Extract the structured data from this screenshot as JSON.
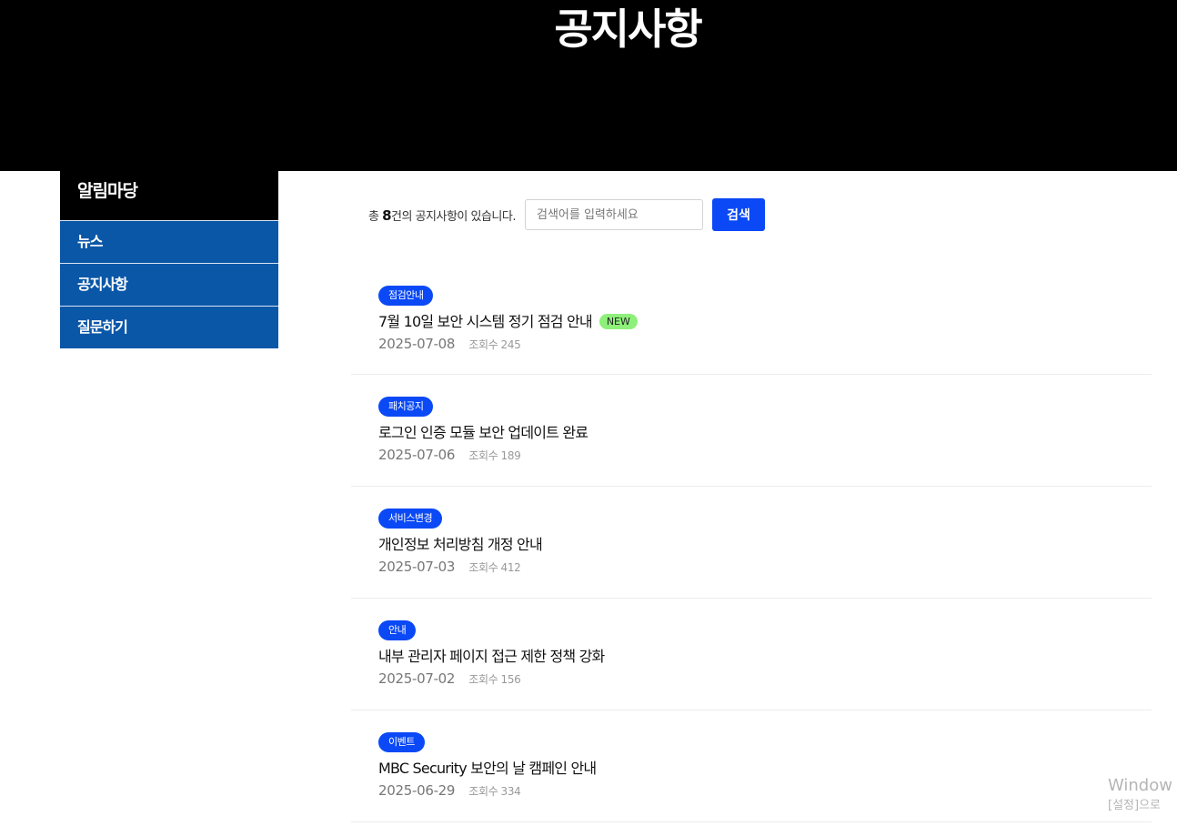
{
  "hero": {
    "title": "공지사항"
  },
  "sidebar": {
    "title": "알림마당",
    "items": [
      {
        "label": "뉴스"
      },
      {
        "label": "공지사항"
      },
      {
        "label": "질문하기"
      }
    ]
  },
  "toolbar": {
    "count_prefix": "총 ",
    "count": "8",
    "count_suffix": "건의 공지사항이 있습니다.",
    "search_placeholder": "검색어를 입력하세요",
    "search_value": "",
    "search_button": "검색"
  },
  "posts": [
    {
      "tag": "점검안내",
      "title": "7월 10일 보안 시스템 정기 점검 안내",
      "new_badge": "NEW",
      "date": "2025-07-08",
      "views_label": "조회수",
      "views": "245"
    },
    {
      "tag": "패치공지",
      "title": "로그인 인증 모듈 보안 업데이트 완료",
      "date": "2025-07-06",
      "views_label": "조회수",
      "views": "189"
    },
    {
      "tag": "서비스변경",
      "title": "개인정보 처리방침 개정 안내",
      "date": "2025-07-03",
      "views_label": "조회수",
      "views": "412"
    },
    {
      "tag": "안내",
      "title": "내부 관리자 페이지 접근 제한 정책 강화",
      "date": "2025-07-02",
      "views_label": "조회수",
      "views": "156"
    },
    {
      "tag": "이벤트",
      "title": "MBC Security 보안의 날 캠페인 안내",
      "date": "2025-06-29",
      "views_label": "조회수",
      "views": "334"
    }
  ],
  "watermark": {
    "line1": "Window",
    "line2": "[설정]으로"
  },
  "colors": {
    "hero_bg": "#000000",
    "sidebar_item_bg": "#0a57a8",
    "accent_blue": "#0a49f5",
    "new_badge_bg": "#8ef07a"
  }
}
